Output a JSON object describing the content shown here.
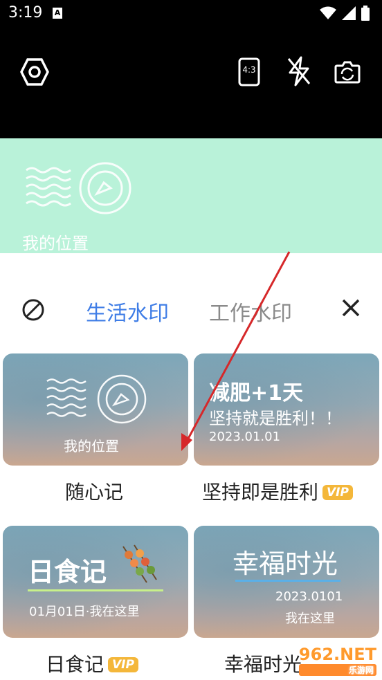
{
  "status_bar": {
    "time": "3:19",
    "app_badge": "A",
    "icons": [
      "wifi-icon",
      "signal-icon",
      "battery-icon"
    ]
  },
  "toolbar": {
    "ratio_label": "4:3",
    "icons": [
      "settings-icon",
      "aspect-ratio-icon",
      "flash-off-icon",
      "switch-camera-icon"
    ]
  },
  "preview": {
    "location_label": "我的位置"
  },
  "tabs": {
    "items": [
      {
        "label": "生活水印"
      },
      {
        "label": "工作水印"
      }
    ],
    "active_index": 0
  },
  "templates": [
    {
      "title": "随心记",
      "vip": false,
      "card_text": "我的位置"
    },
    {
      "title": "坚持即是胜利",
      "vip": true,
      "vip_label": "VIP",
      "card_text1": "减肥+1天",
      "card_text2": "坚持就是胜利！！",
      "card_date": "2023.01.01"
    },
    {
      "title": "日食记",
      "vip": true,
      "vip_label": "VIP",
      "card_text1": "日食记",
      "card_text2": "01月01日·我在这里"
    },
    {
      "title": "幸福时光",
      "vip": false,
      "card_text1": "幸福时光",
      "card_date": "2023.0101",
      "card_text2": "我在这里"
    }
  ],
  "overlay": {
    "site_watermark": "962.NET",
    "site_sub": "乐游网",
    "arrow_color": "#d6282a"
  },
  "colors": {
    "accent": "#3f7de6",
    "preview_bg": "#b9f2d9",
    "vip": "#f4b73a"
  }
}
